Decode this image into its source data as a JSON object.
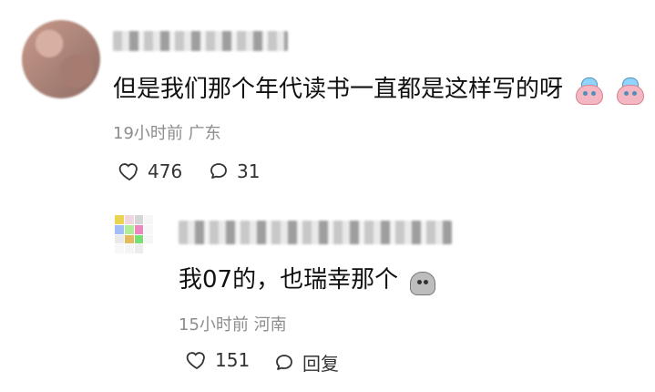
{
  "comments": [
    {
      "text": "但是我们那个年代读书一直都是这样写的呀",
      "time": "19小时前",
      "location": "广东",
      "likes": "476",
      "replies": "31",
      "emojis": [
        "blue-hat-face-emoji",
        "blue-hat-face-emoji"
      ]
    },
    {
      "text": "我07的，也瑞幸那个",
      "time": "15小时前",
      "location": "河南",
      "likes": "151",
      "reply_label": "回复",
      "emojis": [
        "gray-face-emoji"
      ]
    }
  ],
  "colors": {
    "primary_text": "#111111",
    "secondary_text": "#8d8d8d",
    "icon": "#333333"
  }
}
